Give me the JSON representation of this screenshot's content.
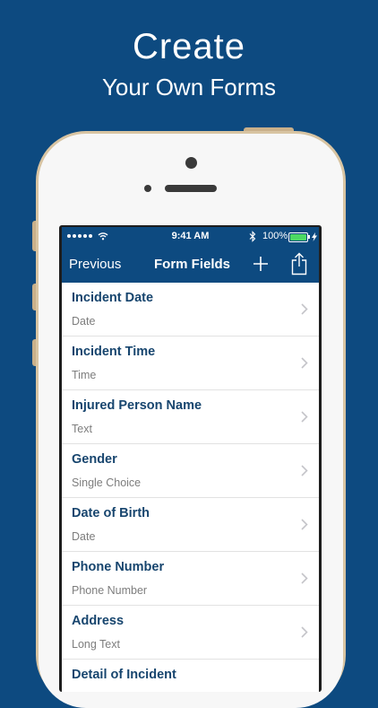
{
  "headline": {
    "line1": "Create",
    "line2": "Your Own Forms"
  },
  "status_bar": {
    "time": "9:41 AM",
    "battery": "100%"
  },
  "nav": {
    "back_label": "Previous",
    "title": "Form Fields",
    "add_icon": "plus-icon",
    "share_icon": "share-icon"
  },
  "fields": [
    {
      "title": "Incident Date",
      "type": "Date"
    },
    {
      "title": "Incident Time",
      "type": "Time"
    },
    {
      "title": "Injured Person Name",
      "type": "Text"
    },
    {
      "title": "Gender",
      "type": "Single Choice"
    },
    {
      "title": "Date of Birth",
      "type": "Date"
    },
    {
      "title": "Phone Number",
      "type": "Phone Number"
    },
    {
      "title": "Address",
      "type": "Long Text"
    },
    {
      "title": "Detail of Incident",
      "type": ""
    }
  ],
  "colors": {
    "brand_blue": "#0d4a80",
    "title_text": "#17456e",
    "subtitle_text": "#7d7d7d",
    "phone_gold": "#d8c4a2"
  }
}
